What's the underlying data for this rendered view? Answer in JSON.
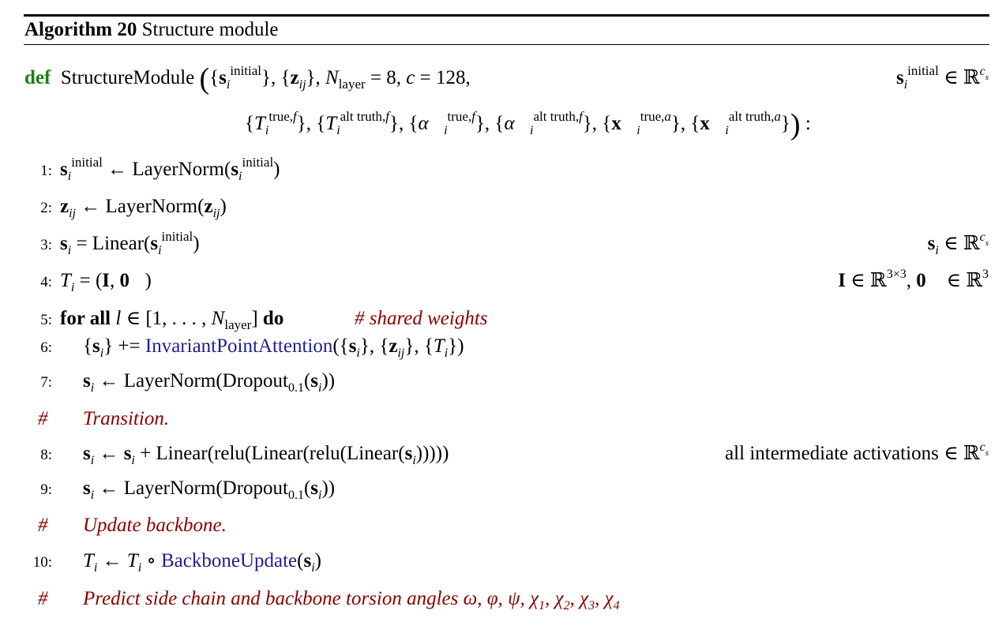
{
  "algorithm": {
    "number_label": "Algorithm 20",
    "title": "Structure module"
  },
  "def_line": {
    "keyword": "def",
    "function_name": "StructureModule",
    "args_line1": "{s_i^initial}, {z_ij}, N_layer = 8, c = 128,",
    "args_line2": "{T_i^true,f}, {T_i^alt truth,f}, {α_i^true,f}, {α_i^alt truth,f}, {x_i^true,a}, {x_i^alt truth,a}",
    "right_annotation": "s_i^initial ∈ ℝ^c_s"
  },
  "lines": [
    {
      "num": "1:",
      "code": "s_i^initial ← LayerNorm(s_i^initial)"
    },
    {
      "num": "2:",
      "code": "z_ij ← LayerNorm(z_ij)"
    },
    {
      "num": "3:",
      "code": "s_i = Linear(s_i^initial)",
      "annotation": "s_i ∈ ℝ^c_s"
    },
    {
      "num": "4:",
      "code": "T_i = (I, 0)",
      "annotation": "I ∈ ℝ^3×3, 0 ∈ ℝ^3"
    },
    {
      "num": "5:",
      "code": "for all l ∈ [1, ..., N_layer] do",
      "comment": "# shared weights"
    },
    {
      "num": "6:",
      "code": "{s_i} += InvariantPointAttention({s_i}, {z_ij}, {T_i})"
    },
    {
      "num": "7:",
      "code": "s_i ← LayerNorm(Dropout_0.1(s_i))"
    },
    {
      "num": "#",
      "comment": "Transition."
    },
    {
      "num": "8:",
      "code": "s_i ← s_i + Linear(relu(Linear(relu(Linear(s_i)))))",
      "annotation": "all intermediate activations ∈ ℝ^c_s"
    },
    {
      "num": "9:",
      "code": "s_i ← LayerNorm(Dropout_0.1(s_i))"
    },
    {
      "num": "#",
      "comment": "Update backbone."
    },
    {
      "num": "10:",
      "code": "T_i ← T_i ∘ BackboneUpdate(s_i)"
    },
    {
      "num": "#",
      "comment": "Predict side chain and backbone torsion angles ω, φ, ψ, χ1, χ2, χ3, χ4"
    }
  ],
  "labels": {
    "comment_shared": "# shared weights",
    "transition": "Transition.",
    "update_backbone": "Update backbone.",
    "predict_torsion": "Predict side chain and backbone torsion angles",
    "hash": "#",
    "for_all": "for all",
    "do": "do",
    "all_intermediate": "all intermediate activations",
    "layernorm": "LayerNorm",
    "linear": "Linear",
    "ipa": "InvariantPointAttention",
    "backbone_update": "BackboneUpdate"
  }
}
